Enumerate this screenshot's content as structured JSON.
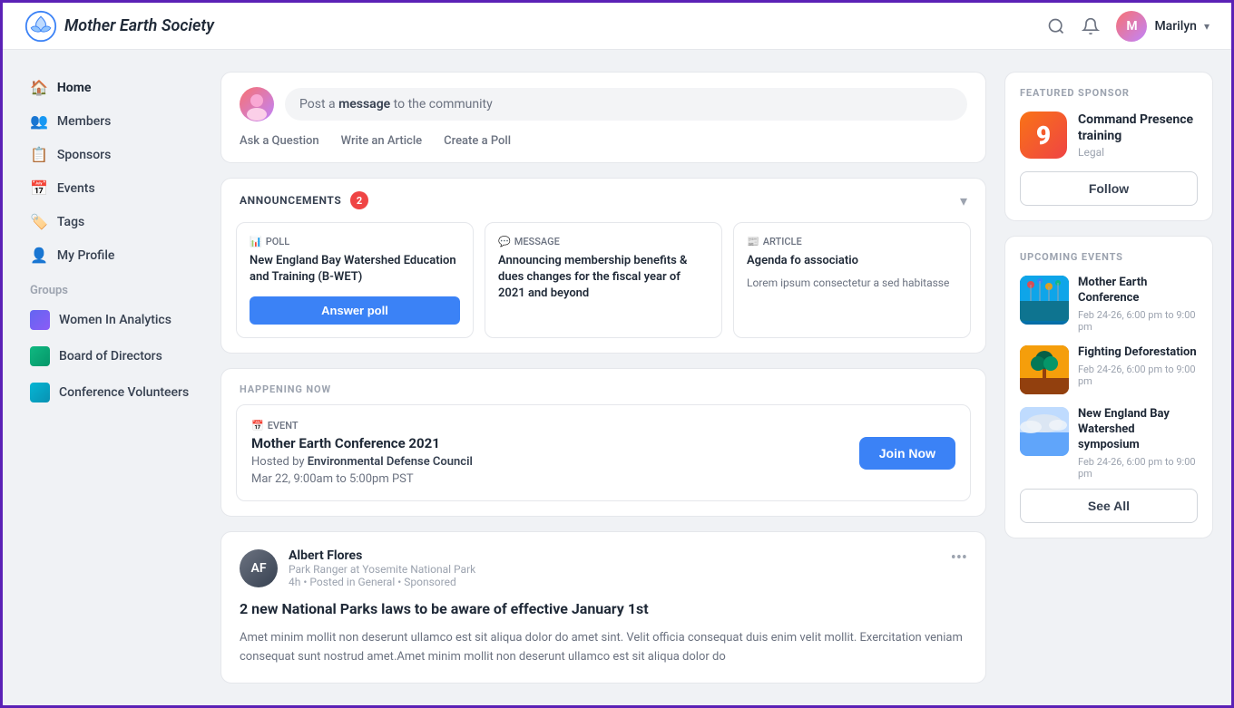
{
  "topnav": {
    "logo_text": "Mother Earth Society",
    "username": "Marilyn"
  },
  "sidebar": {
    "nav_items": [
      {
        "id": "home",
        "label": "Home",
        "icon": "🏠",
        "active": true
      },
      {
        "id": "members",
        "label": "Members",
        "icon": "👥",
        "active": false
      },
      {
        "id": "sponsors",
        "label": "Sponsors",
        "icon": "📋",
        "active": false
      },
      {
        "id": "events",
        "label": "Events",
        "icon": "📅",
        "active": false
      },
      {
        "id": "tags",
        "label": "Tags",
        "icon": "🏷️",
        "active": false
      },
      {
        "id": "myprofile",
        "label": "My Profile",
        "icon": "👤",
        "active": false
      }
    ],
    "groups_title": "Groups",
    "groups": [
      {
        "id": "women-analytics",
        "label": "Women In Analytics",
        "color": "women"
      },
      {
        "id": "board-directors",
        "label": "Board of Directors",
        "color": "board"
      },
      {
        "id": "conf-volunteers",
        "label": "Conference Volunteers",
        "color": "conf"
      }
    ]
  },
  "post_box": {
    "placeholder_prefix": "Post a ",
    "placeholder_bold": "message",
    "placeholder_suffix": " to the community",
    "action1": "Ask a Question",
    "action2": "Write an Article",
    "action3": "Create a Poll"
  },
  "announcements": {
    "title": "ANNOUNCEMENTS",
    "badge_count": "2",
    "items": [
      {
        "type": "POLL",
        "type_icon": "📊",
        "title": "New England Bay Watershed Education and Training (B-WET)",
        "cta": "Answer poll"
      },
      {
        "type": "MESSAGE",
        "type_icon": "💬",
        "title": "Announcing membership benefits & dues changes for the fiscal year of 2021 and beyond",
        "cta": null
      },
      {
        "type": "ARTICLE",
        "type_icon": "📰",
        "title": "Agenda fo associatio",
        "body": "Lorem ipsum consectetur a sed habitasse",
        "cta": null
      }
    ]
  },
  "happening_now": {
    "section_title": "HAPPENING NOW",
    "event": {
      "type": "EVENT",
      "type_icon": "📅",
      "title": "Mother Earth Conference 2021",
      "host_prefix": "Hosted by ",
      "host": "Environmental Defense Council",
      "date": "Mar 22, 9:00am to 5:00pm PST",
      "cta": "Join Now"
    }
  },
  "post_card": {
    "user_name": "Albert Flores",
    "user_title": "Park Ranger at Yosemite National Park",
    "user_meta": "4h • Posted in General • Sponsored",
    "post_title": "2 new National Parks laws to be aware of effective January 1st",
    "post_body": "Amet minim mollit non deserunt ullamco est sit aliqua dolor do amet sint. Velit officia consequat duis enim velit mollit. Exercitation veniam consequat sunt nostrud amet.Amet minim mollit non deserunt ullamco est sit aliqua dolor do"
  },
  "featured_sponsor": {
    "section_title": "FEATURED SPONSOR",
    "logo_text": "9",
    "name": "Command Presence training",
    "category": "Legal",
    "follow_label": "Follow"
  },
  "upcoming_events": {
    "section_title": "UPCOMING EVENTS",
    "events": [
      {
        "name": "Mother Earth Conference",
        "date": "Feb 24-26, 6:00 pm to 9:00 pm",
        "thumb_class": "thumb-conf"
      },
      {
        "name": "Fighting Deforestation",
        "date": "Feb 24-26, 6:00 pm to 9:00 pm",
        "thumb_class": "thumb-defo"
      },
      {
        "name": "New England Bay Watershed symposium",
        "date": "Feb 24-26, 6:00 pm to 9:00 pm",
        "thumb_class": "thumb-bay"
      }
    ],
    "see_all_label": "See All"
  }
}
